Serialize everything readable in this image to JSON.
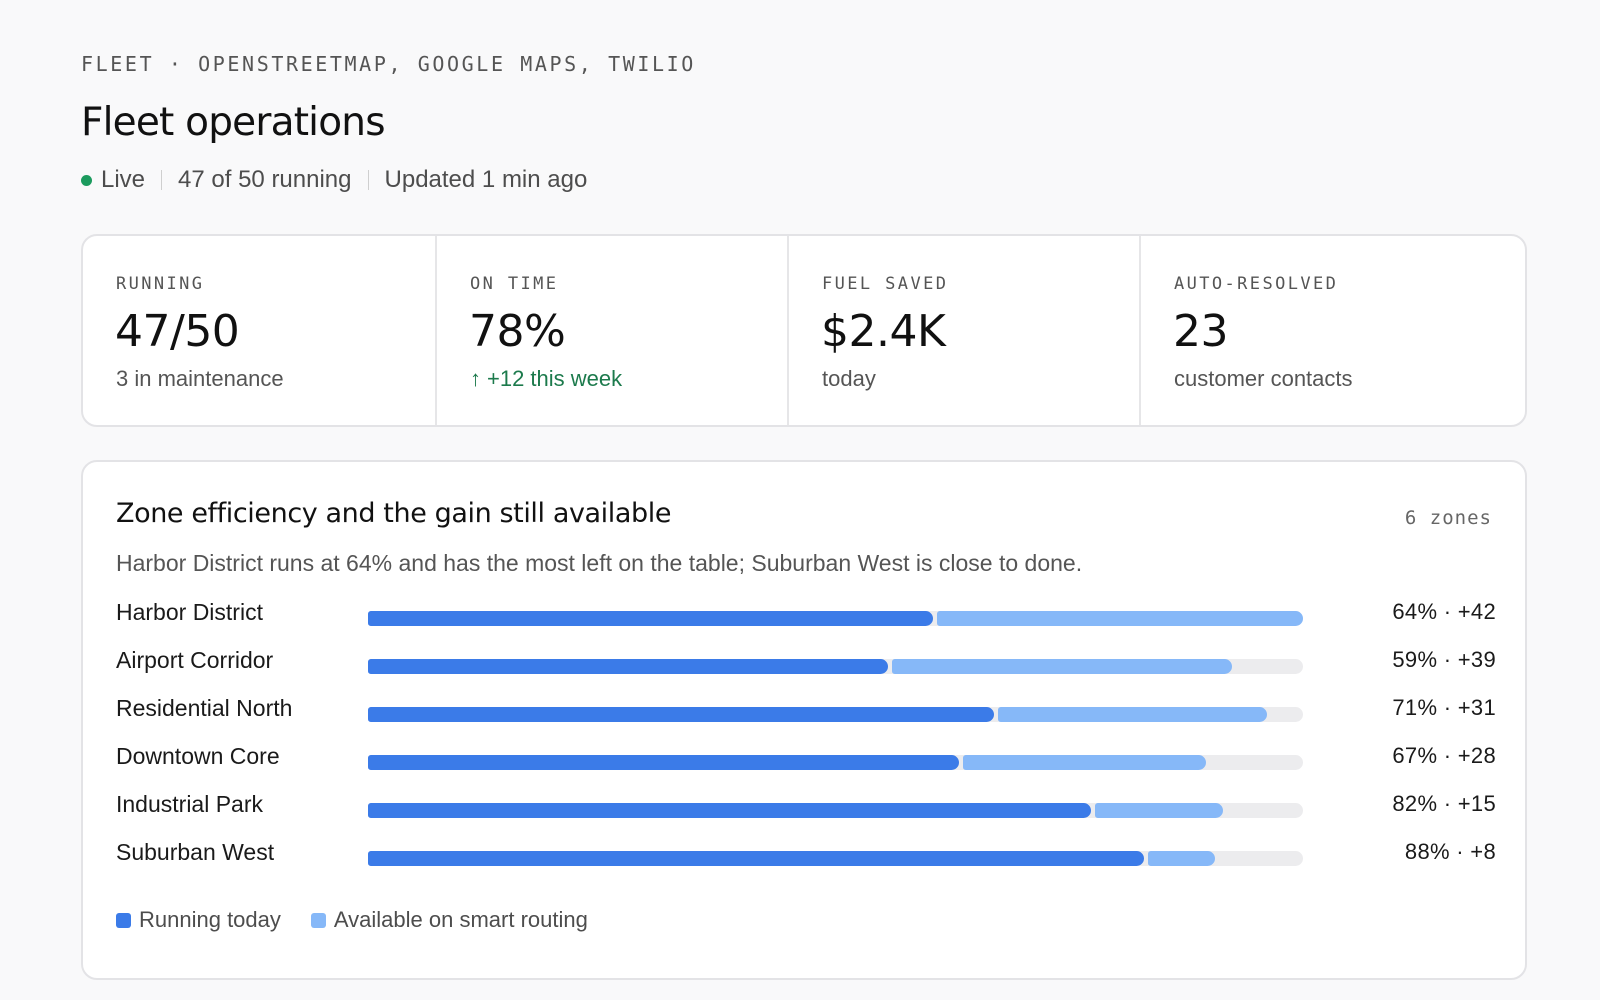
{
  "header": {
    "eyebrow": "FLEET · OPENSTREETMAP, GOOGLE MAPS, TWILIO",
    "title": "Fleet operations",
    "status": {
      "live": "Live",
      "running": "47 of 50 running",
      "updated": "Updated 1 min ago"
    }
  },
  "kpis": [
    {
      "label": "RUNNING",
      "value": "47/50",
      "sub": "3 in maintenance"
    },
    {
      "label": "ON TIME",
      "value": "78%",
      "sub": "+12 this week",
      "trend": "up"
    },
    {
      "label": "FUEL SAVED",
      "value": "$2.4K",
      "sub": "today"
    },
    {
      "label": "AUTO-RESOLVED",
      "value": "23",
      "sub": "customer contacts"
    }
  ],
  "colors": {
    "running": "#3b7be8",
    "available": "#86b8f8",
    "track": "#ececee",
    "live": "#1c9b5e",
    "positive": "#1c7a4c"
  },
  "zone_panel": {
    "title": "Zone efficiency and the gain still available",
    "count": "6 zones",
    "subtitle": "Harbor District runs at 64% and has the most left on the table; Suburban West is close to done.",
    "legend": {
      "running": "Running today",
      "available": "Available on smart routing"
    }
  },
  "chart_data": {
    "type": "bar",
    "orientation": "horizontal",
    "stacked": true,
    "categories": [
      "Harbor District",
      "Airport Corridor",
      "Residential North",
      "Downtown Core",
      "Industrial Park",
      "Suburban West"
    ],
    "series": [
      {
        "name": "Running today",
        "values": [
          64,
          59,
          71,
          67,
          82,
          88
        ]
      },
      {
        "name": "Available on smart routing",
        "values": [
          42,
          39,
          31,
          28,
          15,
          8
        ]
      }
    ],
    "labels": [
      "64% · +42",
      "59% · +39",
      "71% · +31",
      "67% · +28",
      "82% · +15",
      "88% · +8"
    ],
    "xlim": [
      0,
      106
    ]
  }
}
